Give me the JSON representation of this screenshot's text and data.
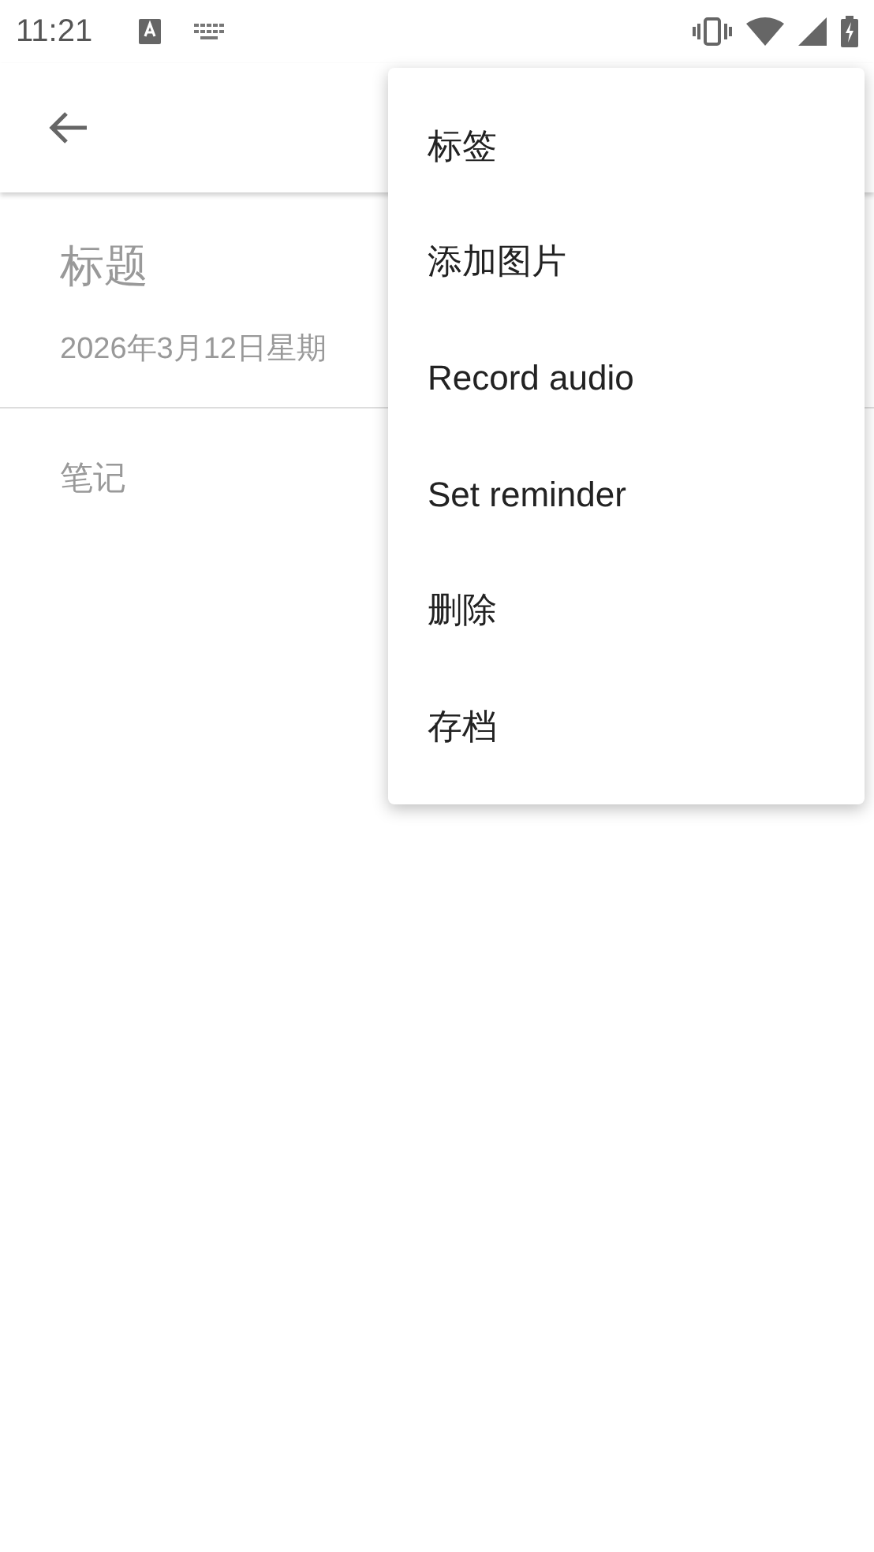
{
  "status_bar": {
    "time": "11:21"
  },
  "note": {
    "title": {
      "placeholder": "标题"
    },
    "date": "2026年3月12日星期",
    "body": {
      "placeholder": "笔记"
    }
  },
  "menu": {
    "items": [
      {
        "label": "标签"
      },
      {
        "label": "添加图片"
      },
      {
        "label": "Record audio"
      },
      {
        "label": "Set reminder"
      },
      {
        "label": "删除"
      },
      {
        "label": "存档"
      }
    ]
  }
}
